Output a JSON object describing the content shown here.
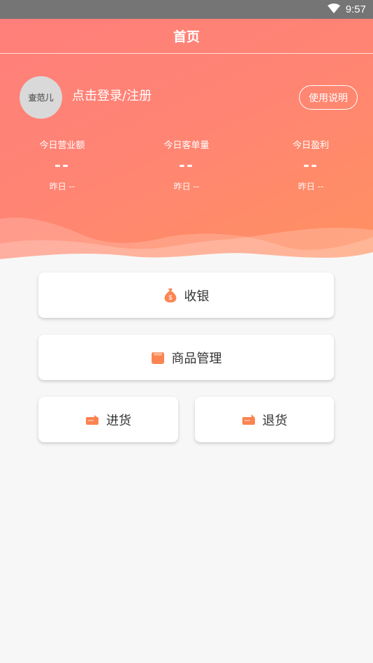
{
  "status_bar": {
    "time": "9:57",
    "wifi_icon": "wifi-icon"
  },
  "header": {
    "title": "首页"
  },
  "profile": {
    "avatar_text": "查范儿",
    "login_label": "点击登录/注册",
    "help_label": "使用说明"
  },
  "stats": [
    {
      "label": "今日营业额",
      "value": "--",
      "yesterday": "昨日 --"
    },
    {
      "label": "今日客单量",
      "value": "--",
      "yesterday": "昨日 --"
    },
    {
      "label": "今日盈利",
      "value": "--",
      "yesterday": "昨日 --"
    }
  ],
  "actions": {
    "cashier": {
      "label": "收银",
      "icon": "money-bag-icon"
    },
    "product_management": {
      "label": "商品管理",
      "icon": "product-icon"
    },
    "purchase": {
      "label": "进货",
      "icon": "purchase-icon"
    },
    "return": {
      "label": "退货",
      "icon": "return-icon"
    }
  },
  "colors": {
    "accent": "#ff8474",
    "accent_light": "#ff9160",
    "icon_orange": "#fb8452"
  }
}
